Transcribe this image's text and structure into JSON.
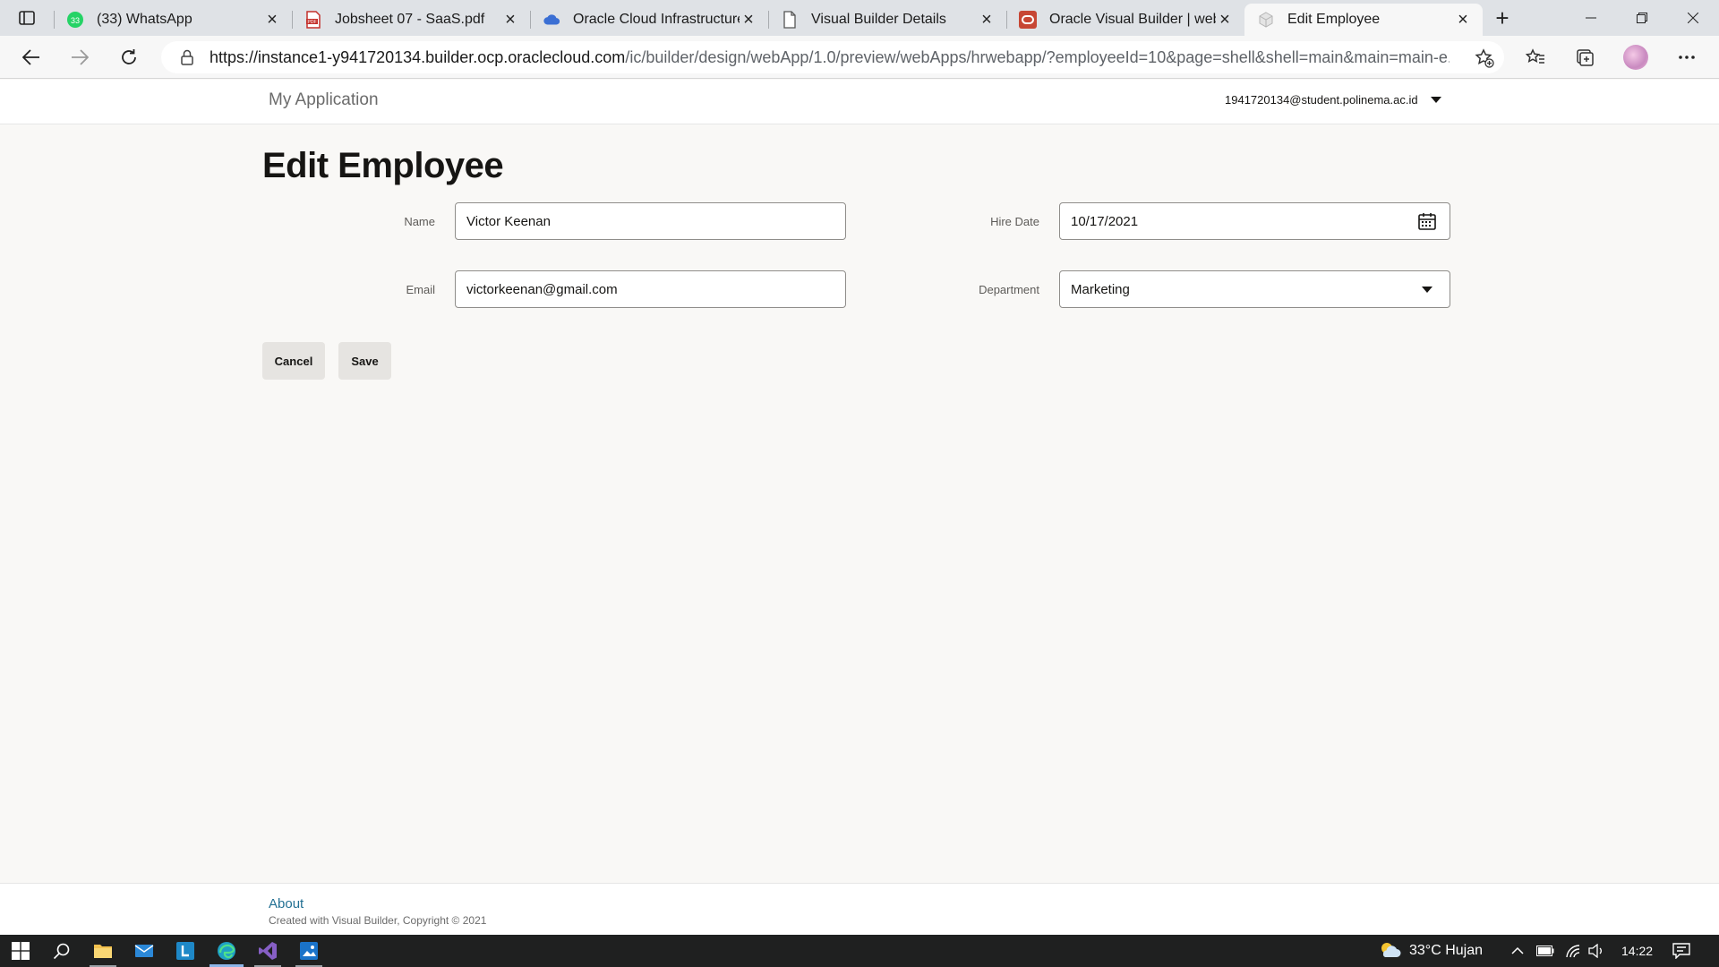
{
  "browser": {
    "tabs": [
      {
        "title": "(33) WhatsApp",
        "icon": "whatsapp-icon",
        "badge": "33"
      },
      {
        "title": "Jobsheet 07 - SaaS.pdf",
        "icon": "pdf-icon"
      },
      {
        "title": "Oracle Cloud Infrastructure",
        "icon": "cloud-icon"
      },
      {
        "title": "Visual Builder Details",
        "icon": "page-icon"
      },
      {
        "title": "Oracle Visual Builder | webA",
        "icon": "oracle-icon"
      },
      {
        "title": "Edit Employee",
        "icon": "cube-icon",
        "active": true
      }
    ],
    "url_host": "https://instance1-y941720134.builder.ocp.oraclecloud.com",
    "url_path": "/ic/builder/design/webApp/1.0/preview/webApps/hrwebapp/?employeeId=10&page=shell&shell=main&main=main-e..."
  },
  "app": {
    "name": "My Application",
    "user": "1941720134@student.polinema.ac.id"
  },
  "page": {
    "title": "Edit Employee",
    "fields": {
      "name": {
        "label": "Name",
        "value": "Victor Keenan"
      },
      "email": {
        "label": "Email",
        "value": "victorkeenan@gmail.com"
      },
      "hire_date": {
        "label": "Hire Date",
        "value": "10/17/2021"
      },
      "department": {
        "label": "Department",
        "value": "Marketing"
      }
    },
    "buttons": {
      "cancel": "Cancel",
      "save": "Save"
    }
  },
  "footer": {
    "about": "About",
    "copyright": "Created with Visual Builder, Copyright © 2021"
  },
  "taskbar": {
    "weather": "33°C  Hujan",
    "time": "14:22"
  },
  "colors": {
    "accent_link": "#227093",
    "page_bg": "#f9f8f6",
    "button_bg": "#e6e4e1"
  }
}
